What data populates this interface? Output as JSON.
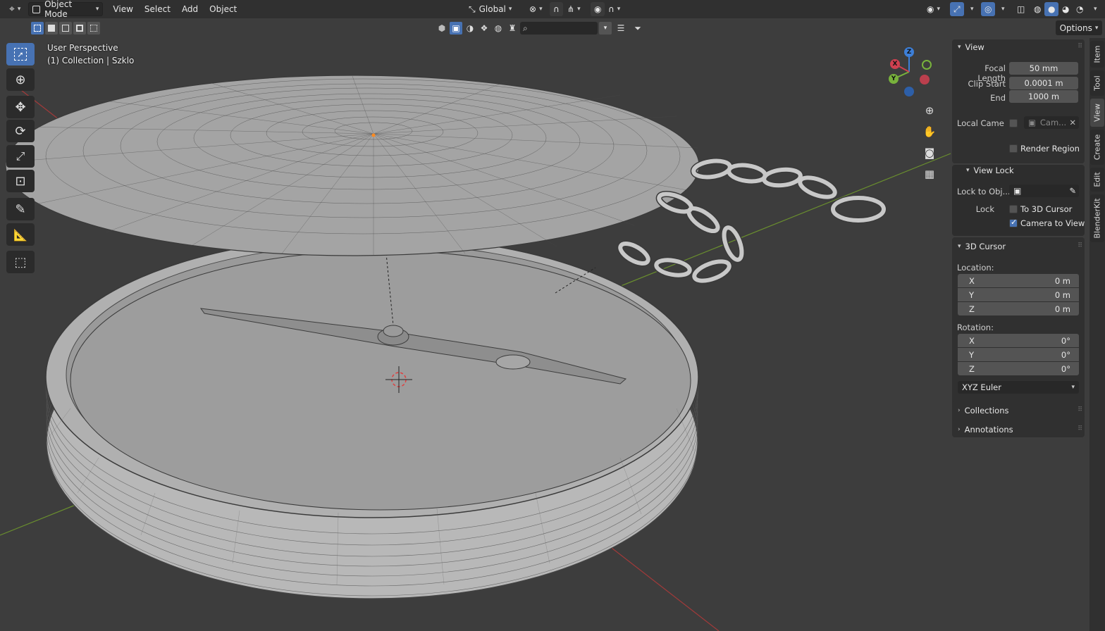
{
  "header": {
    "editor_type_icon": "3d-viewport-icon",
    "mode": "Object Mode",
    "menus": [
      "View",
      "Select",
      "Add",
      "Object"
    ],
    "orientation": "Global",
    "options": "Options"
  },
  "viewport": {
    "perspective_label": "User Perspective",
    "collection_label": "(1) Collection | Szklo"
  },
  "gizmo": {
    "z": "Z",
    "y": "Y",
    "x": "X",
    "colors": {
      "x": "#d04050",
      "y": "#78b23c",
      "z": "#3d7fd8"
    }
  },
  "panel": {
    "view": {
      "title": "View",
      "focal_length_label": "Focal Length",
      "focal_length": "50 mm",
      "clip_start_label": "Clip Start",
      "clip_start": "0.0001 m",
      "end_label": "End",
      "end": "1000 m",
      "local_camera_label": "Local Came",
      "local_camera_value": "Cam...",
      "render_region": "Render Region"
    },
    "view_lock": {
      "title": "View Lock",
      "lock_to_object_label": "Lock to Obj...",
      "lock_label": "Lock",
      "to_3d_cursor": "To 3D Cursor",
      "camera_to_view": "Camera to View",
      "to_3d_cursor_checked": false,
      "camera_to_view_checked": true
    },
    "cursor": {
      "title": "3D Cursor",
      "location_label": "Location:",
      "location": [
        {
          "axis": "X",
          "value": "0 m"
        },
        {
          "axis": "Y",
          "value": "0 m"
        },
        {
          "axis": "Z",
          "value": "0 m"
        }
      ],
      "rotation_label": "Rotation:",
      "rotation": [
        {
          "axis": "X",
          "value": "0°"
        },
        {
          "axis": "Y",
          "value": "0°"
        },
        {
          "axis": "Z",
          "value": "0°"
        }
      ],
      "rotation_mode": "XYZ Euler"
    },
    "collections": "Collections",
    "annotations": "Annotations"
  },
  "tabs": [
    "Item",
    "Tool",
    "View",
    "Create",
    "Edit",
    "BlenderKit"
  ],
  "active_tab": "View"
}
